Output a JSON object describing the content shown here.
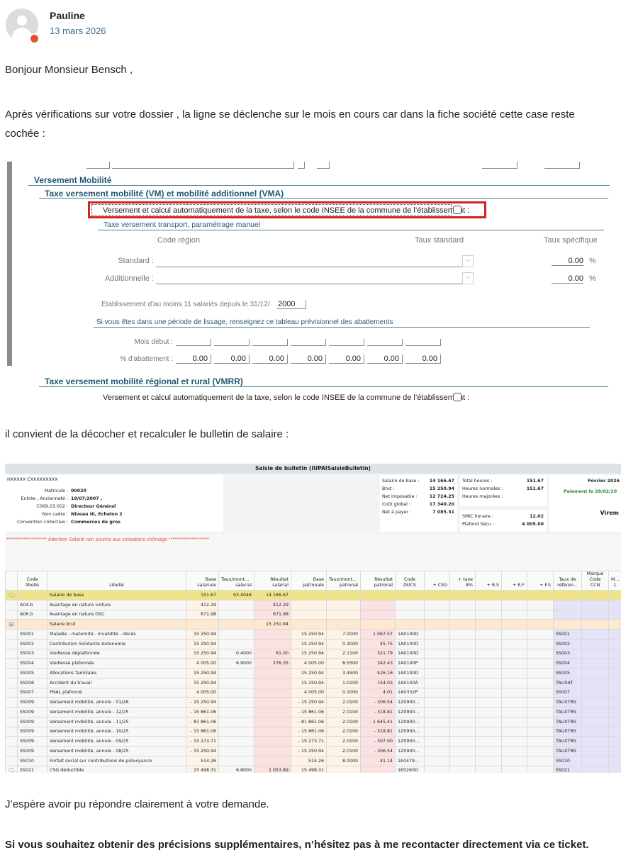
{
  "post": {
    "author": "Pauline",
    "date": "13 mars 2026"
  },
  "message": {
    "greeting": "Bonjour Monsieur Bensch ,",
    "p1": "Après vérifications sur votre dossier , la ligne se déclenche sur le mois en cours car dans la fiche société cette case reste cochée :",
    "p2": "il convient de la décocher et recalculer le bulletin de salaire :",
    "p3": "J’espère avoir pu répondre clairement à votre demande.",
    "p4": "Si vous souhaitez obtenir des précisions supplémentaires, n’hésitez pas à me recontacter directement via ce ticket."
  },
  "form": {
    "section": "Versement Mobilité",
    "vm_title": "Taxe versement mobilité (VM) et mobilité additionnel (VMA)",
    "auto_label": "Versement et calcul automatiquement de la taxe, selon le code INSEE de la commune de l’établissement :",
    "manual_title": "Taxe versement transport, paramétrage manuel",
    "col_code": "Code région",
    "col_std": "Taux standard",
    "col_spec": "Taux spécifique",
    "standard_label": "Standard :",
    "additional_label": "Additionnelle :",
    "standard_value": "0.00",
    "additional_value": "0.00",
    "percent": "%",
    "etab_label": "Etablissement d'au moins 11 salariés depuis le 31/12/",
    "etab_value": "2000",
    "lissage_title": "Si vous êtes dans une période de lissage, renseignez ce tableau prévisionnel des abattements",
    "mois_label": "Mois début :",
    "abatt_label": "% d'abattement :",
    "abatt_values": [
      "0.00",
      "0.00",
      "0.00",
      "0.00",
      "0.00",
      "0.00",
      "0.00"
    ],
    "vmrr_title": "Taxe versement mobilité régional et rural (VMRR)",
    "vmrr_label": "Versement et calcul automatiquement de la taxe, selon le code INSEE de la commune de l’établissement :",
    "highlight_color": "#d42020"
  },
  "bulletin": {
    "title": "Saisie de bulletin (IUPAISaisieBulletin)",
    "employee": "HXXXXX CXXXXXXXXX",
    "info": [
      [
        "Matricule :",
        "00020"
      ],
      [
        "Entrée , Ancienneté :",
        "18/07/2007 ,"
      ],
      [
        "C069.03.002 :",
        "Directeur Général"
      ],
      [
        "Non cadre :",
        "Niveau III, Echelon 2"
      ],
      [
        "Convention collective :",
        "Commerces de gros"
      ]
    ],
    "totals": [
      [
        "Salaire de base :",
        "14 166.67"
      ],
      [
        "Brut :",
        "15 250.94"
      ],
      [
        "Net imposable :",
        "12 724.25"
      ],
      [
        "Coût global :",
        "17 340.20"
      ],
      [
        "Net à payer :",
        "7 085.31"
      ]
    ],
    "hours": [
      [
        "Total heures :",
        "151.67"
      ],
      [
        "Heures normales :",
        "151.67"
      ],
      [
        "Heures majorées :",
        ""
      ]
    ],
    "smic": [
      [
        "SMIC horaire :",
        "12.02"
      ],
      [
        "Plafond Sécu :",
        "4 005.00"
      ]
    ],
    "period": "Février 2026",
    "payment": "Paiement le 28/02/20",
    "method": "Virem",
    "warning": "********************* Attention Salarié non soumis aux cotisations chômage *********************",
    "headers": [
      "Code libellé",
      "Libellé",
      "Base salariale",
      "Taux/montant salarial",
      "Résultat salarial",
      "Base patronale",
      "Taux/montant patronal",
      "Résultat patronal",
      "Code DUCS",
      "+ CSG",
      "+ taxe 8%",
      "+ R.S",
      "+ R.F",
      "+ F.S",
      "Taux de référen...",
      "Marque Code CCN",
      "Marq 1"
    ],
    "rows": [
      [
        "",
        "Salaire de base",
        "151.67",
        "93.4046",
        "14 166.67",
        "",
        "",
        "",
        "",
        "",
        "yel",
        "comment"
      ],
      [
        "A04.b",
        "Avantage en nature voiture",
        "412.29",
        "",
        "412.29",
        "",
        "",
        "",
        "",
        "",
        "",
        ""
      ],
      [
        "A06.b",
        "Avantage en nature GSC",
        "671.98",
        "",
        "671.98",
        "",
        "",
        "",
        "",
        "",
        "",
        ""
      ],
      [
        "",
        "Salaire brut",
        "",
        "",
        "15 250.94",
        "",
        "",
        "",
        "",
        "",
        "brut",
        "collapse"
      ],
      [
        "SS001",
        "Maladie - maternité - invalidité - décès",
        "15 250.94",
        "",
        "",
        "15 250.94",
        "7.0000",
        "1 067.57",
        "1A0100D",
        "SS001",
        "",
        ""
      ],
      [
        "SS002",
        "Contribution Solidarité Autonomie",
        "15 250.94",
        "",
        "",
        "15 250.94",
        "0.3000",
        "45.75",
        "1A0100D",
        "SS002",
        "",
        ""
      ],
      [
        "SS003",
        "Vieillesse déplafonnée",
        "15 250.94",
        "0.4000",
        "61.00",
        "15 250.94",
        "2.1100",
        "321.79",
        "1A0100D",
        "SS003",
        "",
        ""
      ],
      [
        "SS004",
        "Vieillesse plafonnée",
        "4 005.00",
        "6.9000",
        "276.35",
        "4 005.00",
        "8.5500",
        "342.43",
        "1A0100P",
        "SS004",
        "",
        ""
      ],
      [
        "SS005",
        "Allocations familiales",
        "15 250.94",
        "",
        "",
        "15 250.94",
        "3.4500",
        "526.16",
        "1A0100D",
        "SS005",
        "",
        ""
      ],
      [
        "SS006",
        "Accident du travail",
        "15 250.94",
        "",
        "",
        "15 250.94",
        "1.0100",
        "154.03",
        "1A0100A",
        "TAUXAT",
        "",
        ""
      ],
      [
        "SS007",
        "FNAL plafonné",
        "4 005.00",
        "",
        "",
        "4 005.00",
        "0.1000",
        "4.01",
        "1A0332P",
        "SS007",
        "",
        ""
      ],
      [
        "SS009",
        "Versement mobilité, annule - 01/26",
        "- 15 250.94",
        "",
        "",
        "- 15 250.94",
        "2.0100",
        "- 306.54",
        "1Z0900...",
        "TAUXTRS",
        "",
        ""
      ],
      [
        "SS009",
        "Versement mobilité, annule - 12/25",
        "- 15 861.06",
        "",
        "",
        "- 15 861.06",
        "2.0100",
        "- 318.81",
        "1Z0900...",
        "TAUXTRS",
        "",
        ""
      ],
      [
        "SS009",
        "Versement mobilité, annule - 11/25",
        "- 81 861.06",
        "",
        "",
        "- 81 861.06",
        "2.0100",
        "- 1 645.41",
        "1Z0900...",
        "TAUXTRS",
        "",
        ""
      ],
      [
        "SS009",
        "Versement mobilité, annule - 10/25",
        "- 15 861.06",
        "",
        "",
        "- 15 861.06",
        "2.0100",
        "- 318.81",
        "1Z0900...",
        "TAUXTRS",
        "",
        ""
      ],
      [
        "SS009",
        "Versement mobilité, annule - 09/25",
        "- 15 273.71",
        "",
        "",
        "- 15 273.71",
        "2.0100",
        "- 307.00",
        "1Z0900...",
        "TAUXTRS",
        "",
        ""
      ],
      [
        "SS009",
        "Versement mobilité, annule - 08/25",
        "- 15 250.94",
        "",
        "",
        "- 15 250.94",
        "2.0100",
        "- 306.54",
        "1Z0900...",
        "TAUXTRS",
        "",
        ""
      ],
      [
        "SS010",
        "Forfait social sur contributions de prévoyance",
        "514.26",
        "",
        "",
        "514.26",
        "8.0000",
        "41.14",
        "1E0479...",
        "SS010",
        "sep",
        ""
      ],
      [
        "SS021",
        "CSG déductible",
        "15 498.31",
        "6.8000",
        "1 053.89",
        "15 498.31",
        "",
        "",
        "1E0260D",
        "SS021",
        "sep",
        "comment"
      ]
    ]
  }
}
